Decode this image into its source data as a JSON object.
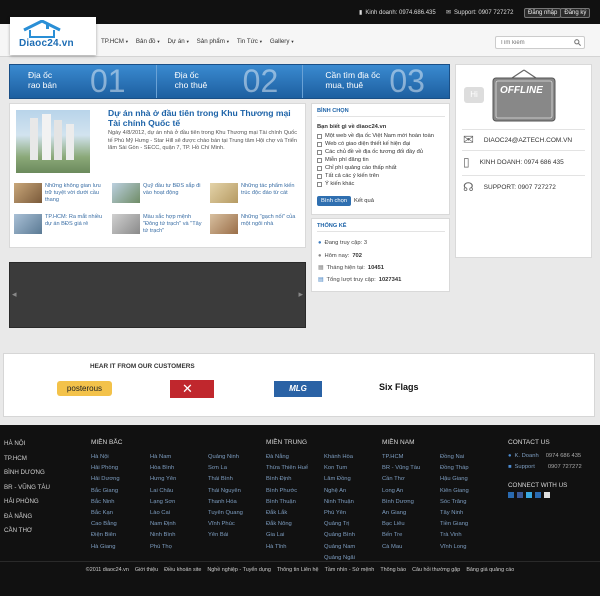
{
  "header": {
    "logo_text": "Diaoc24.vn",
    "business_phone": "Kinh doanh: 0974.686.435",
    "support_phone": "Support: 0907 727272",
    "login_label": "Đăng nhập",
    "register_label": "Đăng ký",
    "search_placeholder": "Tìm kiếm"
  },
  "nav": [
    {
      "label": "TP.HCM"
    },
    {
      "label": "Bản đồ"
    },
    {
      "label": "Dự án"
    },
    {
      "label": "Sản phẩm"
    },
    {
      "label": "Tin Tức"
    },
    {
      "label": "Gallery"
    }
  ],
  "banner": [
    {
      "title": "Địa ốc\nrao bán",
      "number": "01"
    },
    {
      "title": "Địa ốc\ncho thuê",
      "number": "02"
    },
    {
      "title": "Cần tìm địa ốc\nmua, thuê",
      "number": "03"
    }
  ],
  "sidebar": {
    "offline_label": "OFFLINE",
    "email": "DIAOC24@AZTECH.COM.VN",
    "business": "KINH DOANH: 0974 686 435",
    "support": "SUPPORT: 0907 727272"
  },
  "featured": {
    "title": "Dự án nhà ở đầu tiên trong Khu Thương mại Tài chính Quốc tế",
    "description": "Ngày 4/8/2012, dự án nhà ở đầu tiên trong Khu Thương mại Tài chính Quốc tế Phú Mỹ Hưng - Star Hill sẽ được chào bán tại Trung tâm Hội chợ và Triển lãm Sài Gòn - SECC, quận 7, TP. Hồ Chí Minh."
  },
  "news": [
    "Những không gian lưu trữ tuyệt vời dưới cầu thang",
    "Quỹ đầu tư BĐS sắp đi vào hoạt động",
    "Những tác phẩm kiến trúc độc đáo từ cát",
    "TP.HCM: Ra mắt nhiều dự án BĐS giá rẻ",
    "Màu sắc hợp mệnh \"Đông tứ trạch\" và \"Tây tứ trạch\"",
    "Những \"gạch nối\" của một ngôi nhà"
  ],
  "poll": {
    "title": "BÌNH CHỌN",
    "question": "Bạn biết gì về diaoc24.vn",
    "options": [
      "Một web về địa ốc Việt Nam mới hoàn toàn",
      "Web có giao diện thiết kế hiện đại",
      "Các chủ đề về địa ốc tương đối đầy đủ",
      "Miễn phí đăng tin",
      "Chỉ phí quảng cáo thấp nhất",
      "Tất cả các ý kiến trên",
      "Ý kiến khác"
    ],
    "vote_label": "Bình chọn",
    "result_label": "Kết quả"
  },
  "stats": {
    "title": "THỐNG KÊ",
    "online": "Đang truy cập: 3",
    "today_label": "Hôm nay:",
    "today": "702",
    "month_label": "Tháng hiện tại:",
    "month": "10451",
    "total_label": "Tổng lượt truy cập:",
    "total": "1027341"
  },
  "customers": {
    "title": "HEAR IT FROM OUR CUSTOMERS",
    "brands": [
      "posterous",
      "UNDER ARMOUR",
      "MLG",
      "Six Flags"
    ]
  },
  "footer": {
    "left": [
      "HÀ NỘI",
      "TP.HCM",
      "BÌNH DƯƠNG",
      "BR - VŨNG TÀU",
      "HẢI PHÒNG",
      "ĐÀ NẴNG",
      "CẦN THƠ"
    ],
    "mien_bac": {
      "title": "MIỀN BẮC",
      "cols": [
        [
          "Hà Nội",
          "Hải Phòng",
          "Hải Dương",
          "Bắc Giang",
          "Bắc Ninh",
          "Bắc Kạn",
          "Cao Bằng",
          "Điện Biên",
          "Hà Giang"
        ],
        [
          "Hà Nam",
          "Hòa Bình",
          "Hưng Yên",
          "Lai Châu",
          "Lạng Sơn",
          "Lào Cai",
          "Nam Định",
          "Ninh Bình",
          "Phú Thọ"
        ],
        [
          "Quảng Ninh",
          "Sơn La",
          "Thái Bình",
          "Thái Nguyên",
          "Thanh Hóa",
          "Tuyên Quang",
          "Vĩnh Phúc",
          "Yên Bái"
        ]
      ]
    },
    "mien_trung": {
      "title": "MIỀN TRUNG",
      "cols": [
        [
          "Đà Nẵng",
          "Thừa Thiên Huế",
          "Bình Định",
          "Bình Phước",
          "Bình Thuận",
          "Đắk Lắk",
          "Đắk Nông",
          "Gia Lai",
          "Hà Tĩnh"
        ],
        [
          "Khánh Hòa",
          "Kon Tum",
          "Lâm Đồng",
          "Nghệ An",
          "Ninh Thuận",
          "Phú Yên",
          "Quảng Trị",
          "Quảng Bình",
          "Quảng Nam",
          "Quảng Ngãi"
        ]
      ]
    },
    "mien_nam": {
      "title": "MIỀN NAM",
      "cols": [
        [
          "TP.HCM",
          "BR - Vũng Tàu",
          "Cần Thơ",
          "Long An",
          "Bình Dương",
          "An Giang",
          "Bạc Liêu",
          "Bến Tre",
          "Cà Mau"
        ],
        [
          "Đồng Nai",
          "Đồng Tháp",
          "Hậu Giang",
          "Kiên Giang",
          "Sóc Trăng",
          "Tây Ninh",
          "Tiền Giang",
          "Trà Vinh",
          "Vĩnh Long"
        ]
      ]
    },
    "contact": {
      "title": "CONTACT US",
      "business": "K. Doanh",
      "business_phone": "0974 686 435",
      "support": "Support",
      "support_phone": "0907 727272",
      "connect_title": "CONNECT WITH US"
    },
    "bottom_links": [
      "©2011 diaoc24.vn",
      "Giới thiệu",
      "Điều khoản site",
      "Nghề nghiệp - Tuyển dụng",
      "Thông tin Liên hệ",
      "Tầm nhìn - Sứ mệnh",
      "Thông báo",
      "Câu hỏi thường gặp",
      "Bảng giá quảng cáo"
    ]
  }
}
